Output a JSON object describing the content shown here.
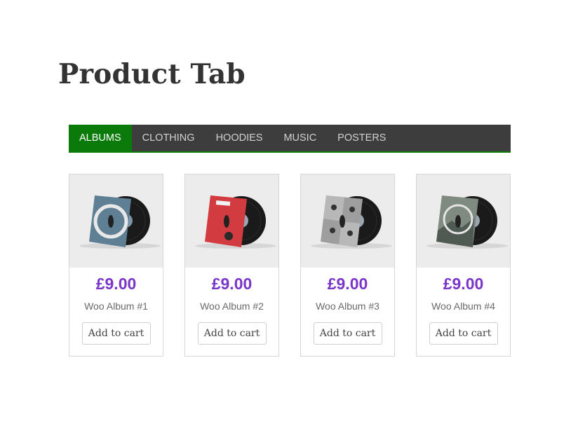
{
  "page": {
    "title": "Product Tab"
  },
  "tabs": [
    {
      "label": "ALBUMS",
      "active": true
    },
    {
      "label": "CLOTHING",
      "active": false
    },
    {
      "label": "HOODIES",
      "active": false
    },
    {
      "label": "MUSIC",
      "active": false
    },
    {
      "label": "POSTERS",
      "active": false
    }
  ],
  "products": [
    {
      "price": "£9.00",
      "name": "Woo Album #1",
      "button": "Add to cart",
      "sleeve_color": "#5f7f95"
    },
    {
      "price": "£9.00",
      "name": "Woo Album #2",
      "button": "Add to cart",
      "sleeve_color": "#d23b3f"
    },
    {
      "price": "£9.00",
      "name": "Woo Album #3",
      "button": "Add to cart",
      "sleeve_color": "#9e9e9e"
    },
    {
      "price": "£9.00",
      "name": "Woo Album #4",
      "button": "Add to cart",
      "sleeve_color": "#7f8a80"
    }
  ],
  "colors": {
    "active_tab": "#0a7a0a",
    "tab_bar": "#3d3d3d",
    "price": "#7a35c9"
  }
}
